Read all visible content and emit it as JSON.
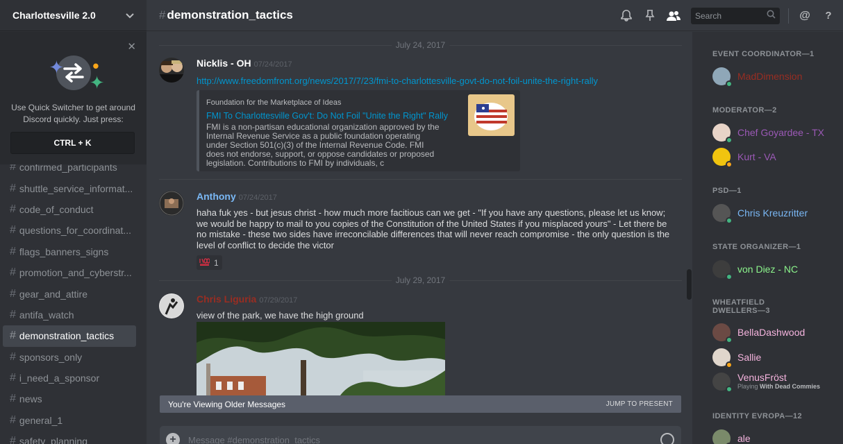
{
  "server": {
    "name": "Charlottesville 2.0"
  },
  "quick_switcher": {
    "text": "Use Quick Switcher to get around Discord quickly. Just press:",
    "shortcut": "CTRL + K"
  },
  "channels": [
    {
      "name": "confirmed_participants",
      "active": false
    },
    {
      "name": "shuttle_service_informat...",
      "active": false
    },
    {
      "name": "code_of_conduct",
      "active": false
    },
    {
      "name": "questions_for_coordinat...",
      "active": false
    },
    {
      "name": "flags_banners_signs",
      "active": false
    },
    {
      "name": "promotion_and_cyberstr...",
      "active": false
    },
    {
      "name": "gear_and_attire",
      "active": false
    },
    {
      "name": "antifa_watch",
      "active": false
    },
    {
      "name": "demonstration_tactics",
      "active": true
    },
    {
      "name": "sponsors_only",
      "active": false
    },
    {
      "name": "i_need_a_sponsor",
      "active": false
    },
    {
      "name": "news",
      "active": false
    },
    {
      "name": "general_1",
      "active": false
    },
    {
      "name": "safety_planning",
      "active": false
    }
  ],
  "header": {
    "hash": "#",
    "channel": "demonstration_tactics",
    "search_placeholder": "Search",
    "mention_symbol": "@",
    "help_symbol": "?"
  },
  "dividers": [
    "July 24, 2017",
    "July 29, 2017"
  ],
  "messages": [
    {
      "author": "Nicklis - OH",
      "author_color": "#ffffff",
      "timestamp": "07/24/2017",
      "link": "http://www.freedomfront.org/news/2017/7/23/fmi-to-charlottesville-govt-do-not-foil-unite-the-right-rally",
      "embed": {
        "provider": "Foundation for the Marketplace of Ideas",
        "title": "FMI To Charlottesville Gov't: Do Not Foil \"Unite the Right\" Rally",
        "description": "FMI is a non-partisan educational organization approved by the Internal Revenue Service as a public foundation operating under Section 501(c)(3) of the Internal Revenue Code.  FMI does not endorse, support, or oppose candidates or proposed legislation. Contributions to FMI by individuals, c"
      }
    },
    {
      "author": "Anthony",
      "author_color": "#7ab8f5",
      "timestamp": "07/24/2017",
      "text": "haha fuk yes - but jesus christ - how much more facitious can we get - \"If you have any questions, please let us know; we would be happy to mail to you copies of the Constitution of the United States if you misplaced yours\"  - Let there be no mistake - these two sides have irreconcilable differences that will never reach compromise - the only question is the level of conflict to decide the victor",
      "reaction": {
        "emoji": "💯",
        "count": "1"
      }
    },
    {
      "author": "Chris Liguria",
      "author_color": "#992d22",
      "timestamp": "07/29/2017",
      "text": "view of the park, we have the high ground"
    }
  ],
  "older_bar": {
    "label": "You're Viewing Older Messages",
    "jump": "JUMP TO PRESENT"
  },
  "composer": {
    "placeholder": "Message #demonstration_tactics"
  },
  "member_groups": [
    {
      "title": "EVENT COORDINATOR—1",
      "members": [
        {
          "name": "MadDimension",
          "color": "#992d22",
          "status": "#43b581"
        }
      ]
    },
    {
      "title": "MODERATOR—2",
      "members": [
        {
          "name": "Chef Goyardee - TX",
          "color": "#9b59b6",
          "status": "#43b581"
        },
        {
          "name": "Kurt - VA",
          "color": "#9b59b6",
          "status": "#faa61a"
        }
      ]
    },
    {
      "title": "PSD—1",
      "members": [
        {
          "name": "Chris Kreuzritter",
          "color": "#7ab8f5",
          "status": "#43b581"
        }
      ]
    },
    {
      "title": "STATE ORGANIZER—1",
      "members": [
        {
          "name": "von Diez - NC",
          "color": "#8cf58c",
          "status": "#43b581"
        }
      ]
    },
    {
      "title": "WHEATFIELD DWELLERS—3",
      "members": [
        {
          "name": "BellaDashwood",
          "color": "#f5b4de",
          "status": "#43b581"
        },
        {
          "name": "Sallie",
          "color": "#f5b4de",
          "status": "#faa61a"
        },
        {
          "name": "VenusFröst",
          "color": "#f5b4de",
          "status": "#43b581",
          "activity_prefix": "Playing",
          "activity": "With Dead Commies"
        }
      ]
    },
    {
      "title": "IDENTITY EVROPA—12",
      "members": [
        {
          "name": "ale",
          "color": "#f5b4de",
          "status": "#43b581"
        }
      ]
    }
  ]
}
